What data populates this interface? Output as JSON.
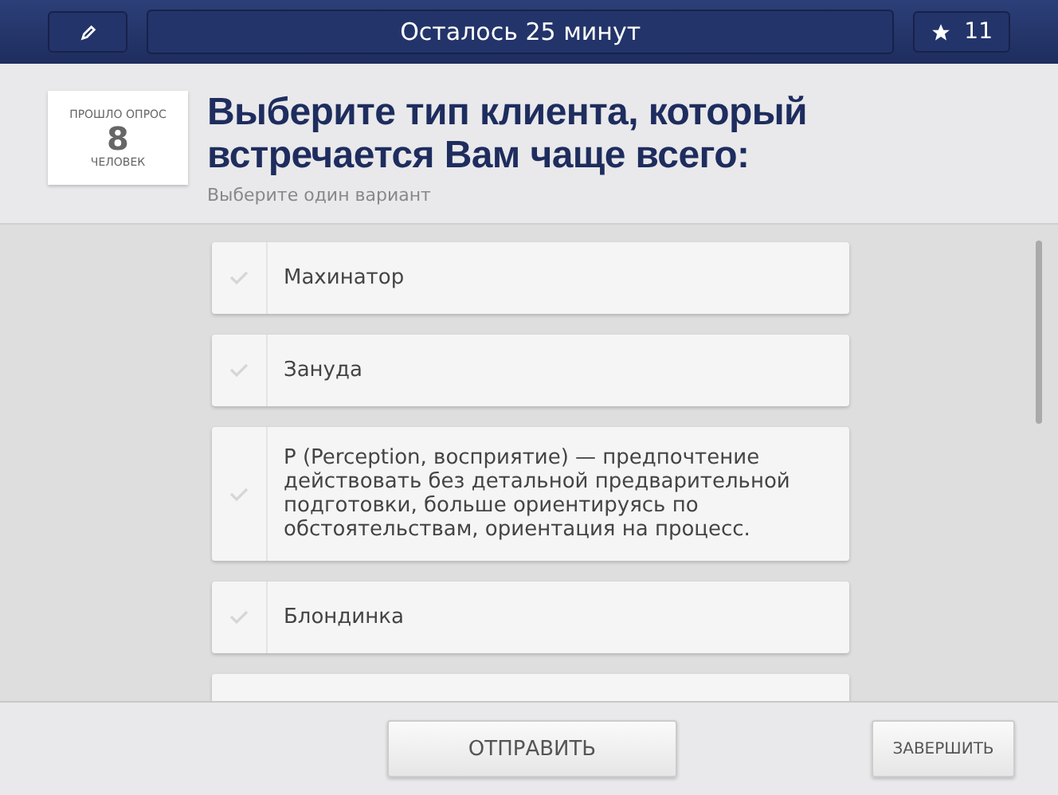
{
  "header": {
    "timer": "Осталось 25 минут",
    "stars": "11"
  },
  "counter": {
    "top": "ПРОШЛО ОПРОС",
    "value": "8",
    "bottom": "ЧЕЛОВЕК"
  },
  "question": {
    "title": "Выберите тип клиента, который встречается Вам чаще всего:",
    "hint": "Выберите один вариант"
  },
  "options": [
    {
      "label": "Махинатор",
      "checked": false
    },
    {
      "label": "Зануда",
      "checked": false
    },
    {
      "label": "P (Perception, восприятие) — предпочтение действовать без детальной предварительной подготовки, больше ориентируясь по обстоятельствам, ориентация на процесс.",
      "checked": false
    },
    {
      "label": "Блондинка",
      "checked": false
    },
    {
      "kind": "partial"
    }
  ],
  "buttons": {
    "submit": "ОТПРАВИТЬ",
    "finish": "ЗАВЕРШИТЬ"
  }
}
